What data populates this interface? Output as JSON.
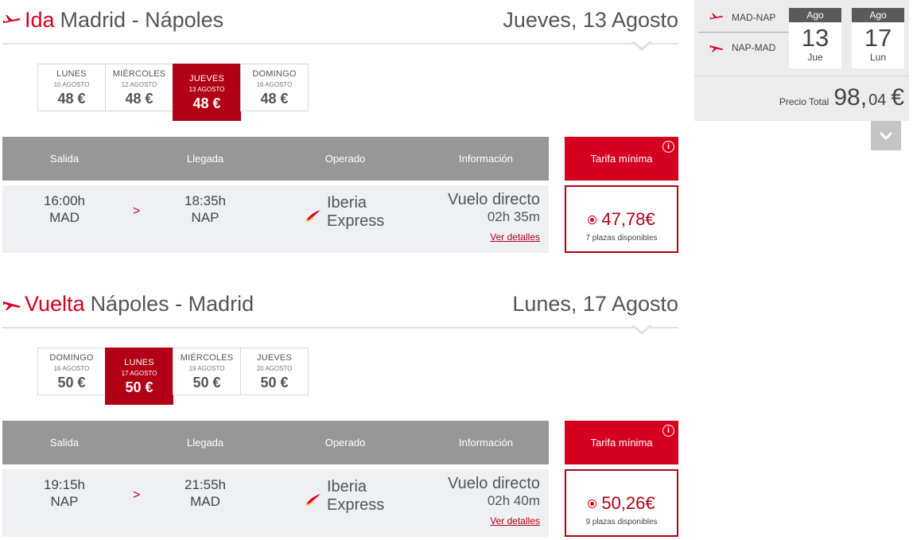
{
  "outbound": {
    "kw": "Ida",
    "route": "Madrid - Nápoles",
    "date": "Jueves, 13 Agosto",
    "days": [
      {
        "name": "LUNES",
        "date": "10 AGOSTO",
        "price": "48 €",
        "active": false
      },
      {
        "name": "MIÉRCOLES",
        "date": "12 AGOSTO",
        "price": "48 €",
        "active": false
      },
      {
        "name": "JUEVES",
        "date": "13 AGOSTO",
        "price": "48 €",
        "active": true
      },
      {
        "name": "DOMINGO",
        "date": "16 AGOSTO",
        "price": "48 €",
        "active": false
      }
    ],
    "flight": {
      "dep_time": "16:00h",
      "dep_code": "MAD",
      "arr_time": "18:35h",
      "arr_code": "NAP",
      "arrow": ">",
      "op1": "Iberia",
      "op2": "Express",
      "info": "Vuelo directo",
      "duration": "02h 35m",
      "details": "Ver detalles",
      "price_int": "47,78",
      "price_cur": "€",
      "seats": "7 plazas disponibles"
    }
  },
  "return": {
    "kw": "Vuelta",
    "route": "Nápoles - Madrid",
    "date": "Lunes, 17 Agosto",
    "days": [
      {
        "name": "DOMINGO",
        "date": "16 AGOSTO",
        "price": "50 €",
        "active": false
      },
      {
        "name": "LUNES",
        "date": "17 AGOSTO",
        "price": "50 €",
        "active": true
      },
      {
        "name": "MIÉRCOLES",
        "date": "19 AGOSTO",
        "price": "50 €",
        "active": false
      },
      {
        "name": "JUEVES",
        "date": "20 AGOSTO",
        "price": "50 €",
        "active": false
      }
    ],
    "flight": {
      "dep_time": "19:15h",
      "dep_code": "NAP",
      "arr_time": "21:55h",
      "arr_code": "MAD",
      "arrow": ">",
      "op1": "Iberia",
      "op2": "Express",
      "info": "Vuelo directo",
      "duration": "02h 40m",
      "details": "Ver detalles",
      "price_int": "50,26",
      "price_cur": "€",
      "seats": "9 plazas disponibles"
    }
  },
  "table_head": {
    "salida": "Salida",
    "llegada": "Llegada",
    "operado": "Operado",
    "informacion": "Información",
    "tarifa": "Tarifa mínima",
    "info_icon": "i"
  },
  "summary": {
    "route_out": "MAD-NAP",
    "route_back": "NAP-MAD",
    "cal_out": {
      "month": "Ago",
      "day": "13",
      "weekday": "Jue"
    },
    "cal_back": {
      "month": "Ago",
      "day": "17",
      "weekday": "Lun"
    },
    "total_label": "Precio Total",
    "total_int": "98,",
    "total_dec": "04",
    "total_cur": "€"
  },
  "icons": {
    "plane_out": "plane-departure-icon",
    "plane_back": "plane-arrival-icon",
    "chevron": "chevron-down-icon",
    "brand_logo": "iberia-logo-icon"
  },
  "colors": {
    "accent": "#d5001f",
    "accent_dark": "#b10015",
    "header_gray": "#979797",
    "row_bg": "#eef0f4"
  }
}
